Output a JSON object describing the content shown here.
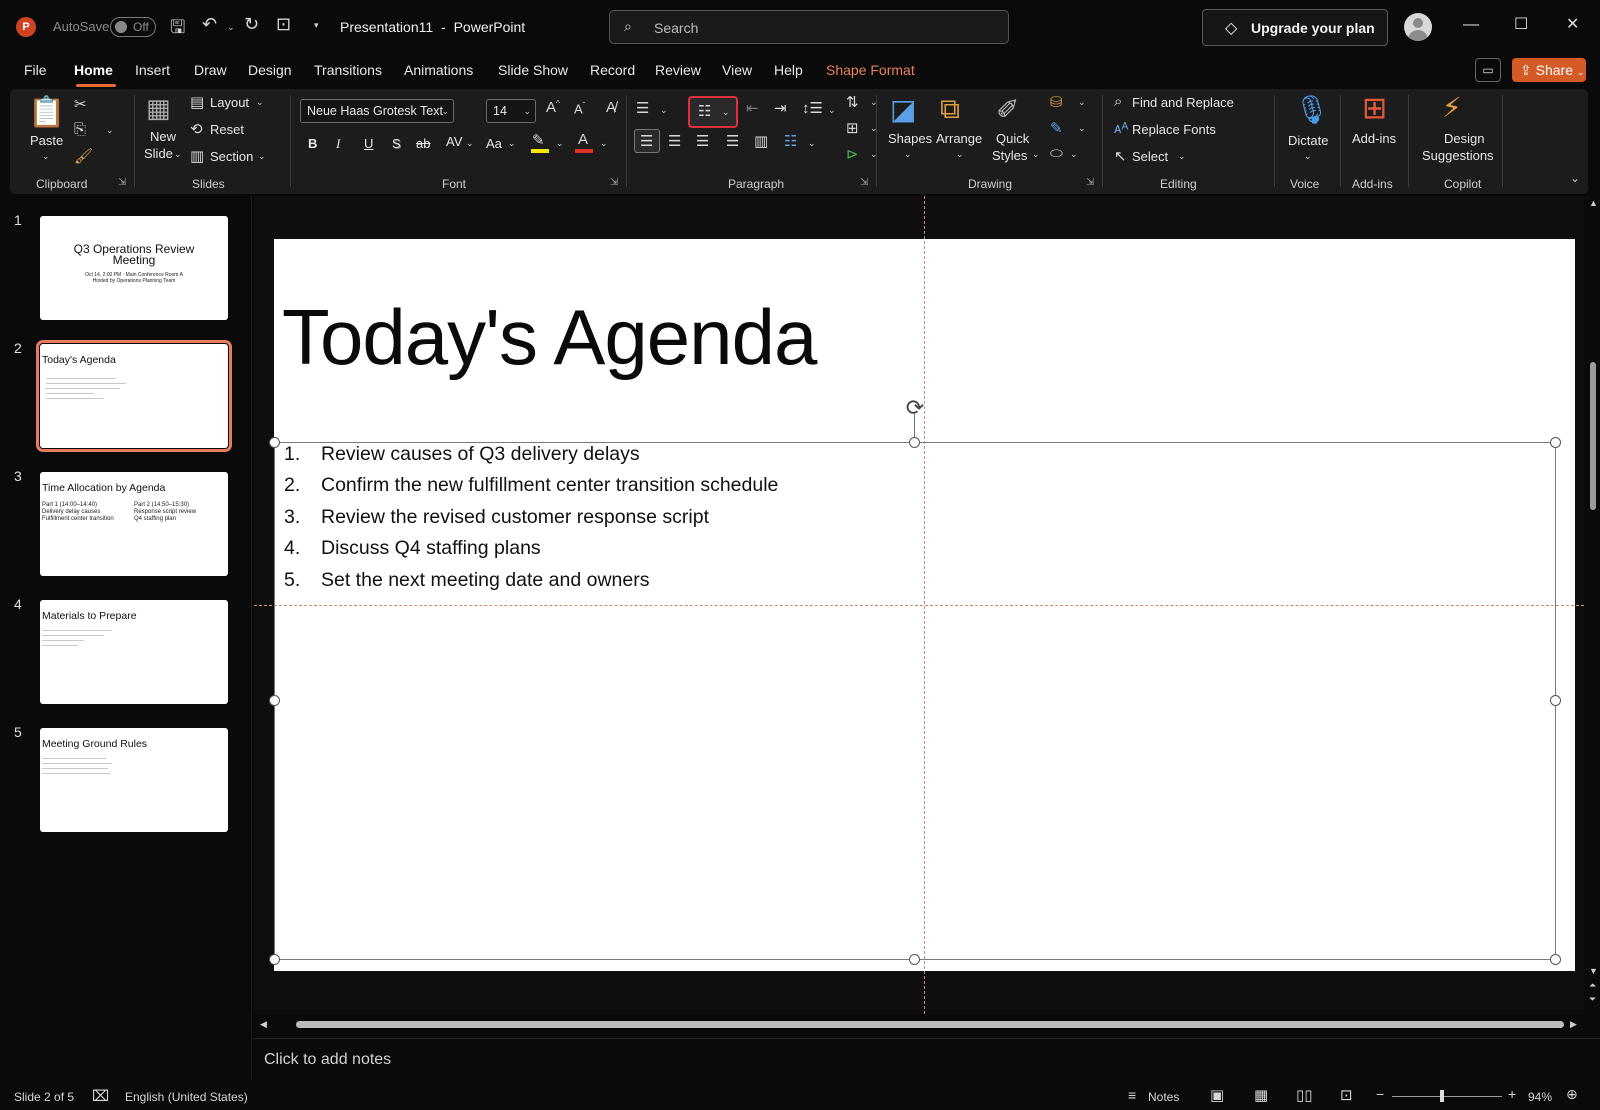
{
  "app": {
    "logo_letter": "P",
    "autosave_label": "AutoSave",
    "autosave_state": "Off",
    "document_title": "Presentation11",
    "separator": "-",
    "app_name": "PowerPoint",
    "search_placeholder": "Search",
    "upgrade_label": "Upgrade your plan"
  },
  "menu": {
    "items": [
      "File",
      "Home",
      "Insert",
      "Draw",
      "Design",
      "Transitions",
      "Animations",
      "Slide Show",
      "Record",
      "Review",
      "View",
      "Help",
      "Shape Format"
    ],
    "active": "Home",
    "share_label": "Share"
  },
  "ribbon": {
    "clipboard": {
      "paste": "Paste",
      "label": "Clipboard"
    },
    "slides": {
      "new_slide_line1": "New",
      "new_slide_line2": "Slide",
      "layout": "Layout",
      "reset": "Reset",
      "section": "Section",
      "label": "Slides"
    },
    "font": {
      "font_name": "Neue Haas Grotesk Text Pro (B",
      "font_size": "14",
      "bold": "B",
      "italic": "I",
      "underline": "U",
      "shadow": "S",
      "strike": "ab",
      "spacing": "AV",
      "case": "Aa",
      "label": "Font"
    },
    "paragraph": {
      "label": "Paragraph"
    },
    "drawing": {
      "shapes": "Shapes",
      "arrange": "Arrange",
      "quick_line1": "Quick",
      "quick_line2": "Styles",
      "label": "Drawing"
    },
    "editing": {
      "find_replace": "Find and Replace",
      "replace_fonts": "Replace Fonts",
      "select": "Select",
      "label": "Editing"
    },
    "voice": {
      "dictate": "Dictate",
      "label": "Voice"
    },
    "addins": {
      "addins": "Add-ins",
      "label": "Add-ins"
    },
    "copilot": {
      "design_line1": "Design",
      "design_line2": "Suggestions",
      "label": "Copilot"
    }
  },
  "colors": {
    "accent": "#e86a35",
    "share_bg": "#d45a26",
    "selection_red": "#e0303a",
    "thumb_selected": "#e87a5d",
    "highlight_yellow": "#f7e600",
    "font_red": "#e0302a"
  },
  "thumbnails": [
    {
      "num": "1",
      "title_line1": "Q3 Operations Review",
      "title_line2": "Meeting",
      "sub1": "Oct 14, 2:00 PM · Main Conference Room A",
      "sub2": "Hosted by Operations Planning Team"
    },
    {
      "num": "2",
      "title": "Today's Agenda"
    },
    {
      "num": "3",
      "title": "Time Allocation by Agenda",
      "col1_head": "Part 1 (14:00–14:40)",
      "col1_a": "Delivery delay causes",
      "col1_b": "Fulfillment center transition",
      "col2_head": "Part 2 (14:50–15:30)",
      "col2_a": "Response script review",
      "col2_b": "Q4 staffing plan"
    },
    {
      "num": "4",
      "title": "Materials to Prepare"
    },
    {
      "num": "5",
      "title": "Meeting Ground Rules"
    }
  ],
  "slide": {
    "title": "Today's Agenda",
    "items": [
      {
        "num": "1.",
        "text": "Review causes of Q3 delivery delays"
      },
      {
        "num": "2.",
        "text": "Confirm the new fulfillment center transition schedule"
      },
      {
        "num": "3.",
        "text": "Review the revised customer response script"
      },
      {
        "num": "4.",
        "text": "Discuss Q4 staffing plans"
      },
      {
        "num": "5.",
        "text": "Set the next meeting date and owners"
      }
    ]
  },
  "notes": {
    "placeholder": "Click to add notes"
  },
  "status": {
    "slide_info": "Slide 2 of 5",
    "language": "English (United States)",
    "notes_label": "Notes",
    "zoom": "94%"
  }
}
